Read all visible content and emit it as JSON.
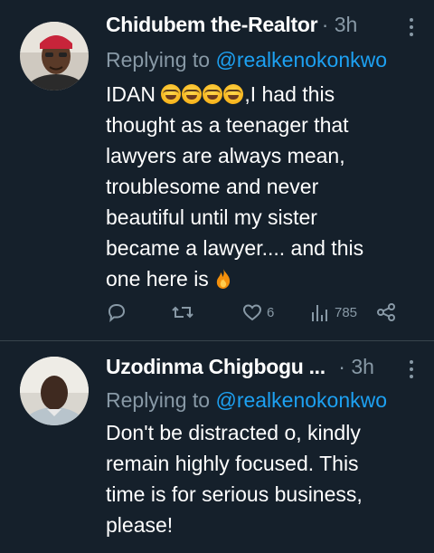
{
  "tweets": [
    {
      "name": "Chidubem the-Realtor",
      "time": "· 3h",
      "replying_prefix": "Replying to",
      "replying_handle": "@realkenokonkwo",
      "text_pre_emoji": "IDAN ",
      "emoji_count": 4,
      "text_lines": [
        ",I had this",
        "thought as a teenager that",
        "lawyers are always  mean,",
        "troublesome and never",
        "beautiful until my sister",
        "became a lawyer.... and this",
        "one here is "
      ],
      "trailing_emoji": "fire-emoji",
      "actions": {
        "likes": "6",
        "views": "785"
      }
    },
    {
      "name": "Uzodinma Chigbogu ...",
      "time": "· 3h",
      "replying_prefix": "Replying to",
      "replying_handle": "@realkenokonkwo",
      "text_lines": [
        "Don't be distracted o, kindly",
        "remain highly focused. This",
        "time is for serious business,",
        "please!"
      ]
    }
  ],
  "colors": {
    "background": "#15202b",
    "secondary_text": "#8899a6",
    "link": "#1da1f2",
    "divider": "#38444d"
  }
}
